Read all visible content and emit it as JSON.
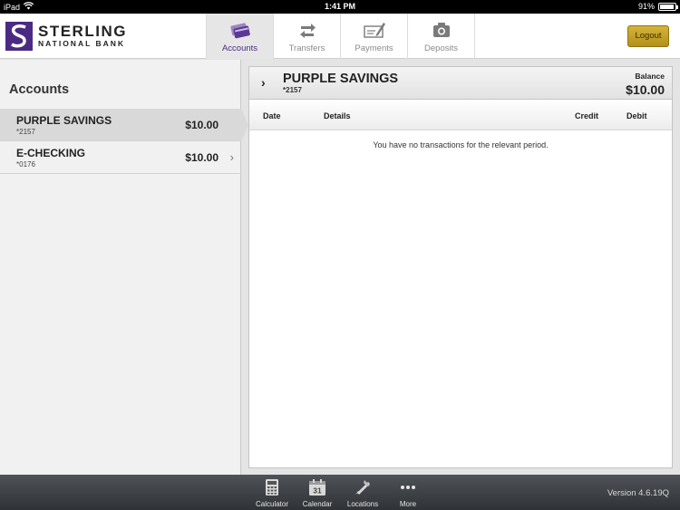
{
  "statusbar": {
    "device": "iPad",
    "time": "1:41 PM",
    "battery": "91%",
    "battery_level": 0.91
  },
  "header": {
    "logo_line1": "STERLING",
    "logo_line2": "NATIONAL BANK",
    "tabs": [
      {
        "label": "Accounts",
        "icon": "credit-cards-icon"
      },
      {
        "label": "Transfers",
        "icon": "transfer-arrows-icon"
      },
      {
        "label": "Payments",
        "icon": "check-pen-icon"
      },
      {
        "label": "Deposits",
        "icon": "camera-icon"
      }
    ],
    "logout_label": "Logout",
    "accent": "#4b2a83"
  },
  "accounts_pane": {
    "title": "Accounts",
    "items": [
      {
        "name": "PURPLE SAVINGS",
        "number": "*2157",
        "amount": "$10.00"
      },
      {
        "name": "E-CHECKING",
        "number": "*0176",
        "amount": "$10.00"
      }
    ]
  },
  "detail": {
    "account_name": "PURPLE SAVINGS",
    "account_number": "*2157",
    "balance_label": "Balance",
    "balance_value": "$10.00",
    "columns": {
      "date": "Date",
      "details": "Details",
      "credit": "Credit",
      "debit": "Debit"
    },
    "empty_message": "You have no transactions for the relevant period."
  },
  "bottombar": {
    "buttons": [
      {
        "label": "Calculator",
        "icon": "calculator-icon"
      },
      {
        "label": "Calendar",
        "icon": "calendar-icon",
        "day": "31"
      },
      {
        "label": "Locations",
        "icon": "map-pin-icon"
      },
      {
        "label": "More",
        "icon": "more-dots-icon"
      }
    ],
    "version": "Version 4.6.19Q"
  }
}
